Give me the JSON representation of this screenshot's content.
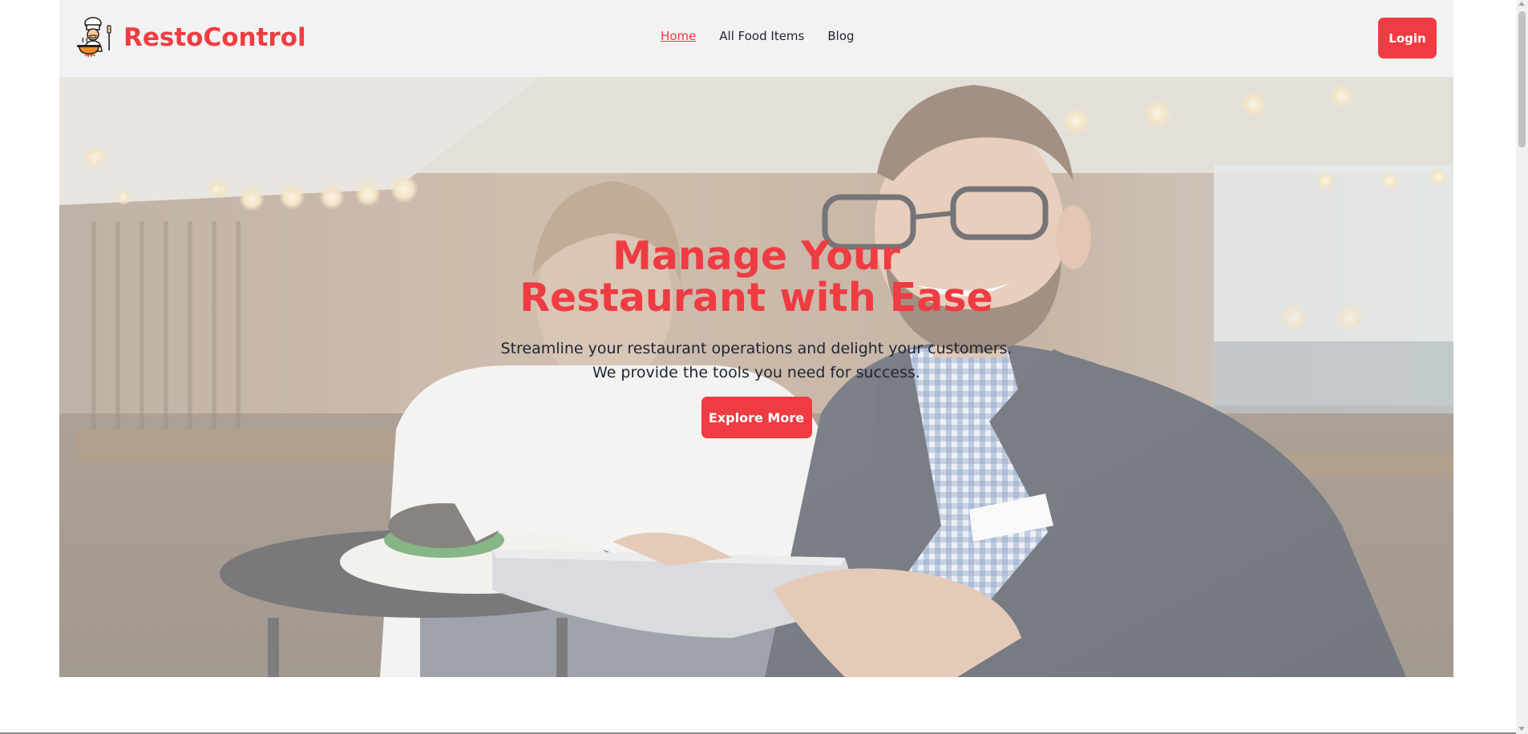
{
  "brand": {
    "name": "RestoControl",
    "logo_icon": "chef-cooking-icon"
  },
  "nav": {
    "items": [
      {
        "label": "Home",
        "active": true
      },
      {
        "label": "All Food Items",
        "active": false
      },
      {
        "label": "Blog",
        "active": false
      }
    ],
    "login_label": "Login"
  },
  "hero": {
    "title": "Manage Your Restaurant with Ease",
    "subtitle_line1": "Streamline your restaurant operations and delight your customers.",
    "subtitle_line2": "We provide the tools you need for success.",
    "cta_label": "Explore More",
    "background_image": "restaurant-staff-with-tablet-photo"
  },
  "colors": {
    "accent": "#ef3c42",
    "navbar_bg": "#f2f2f2",
    "text_dark": "#1f2430"
  }
}
